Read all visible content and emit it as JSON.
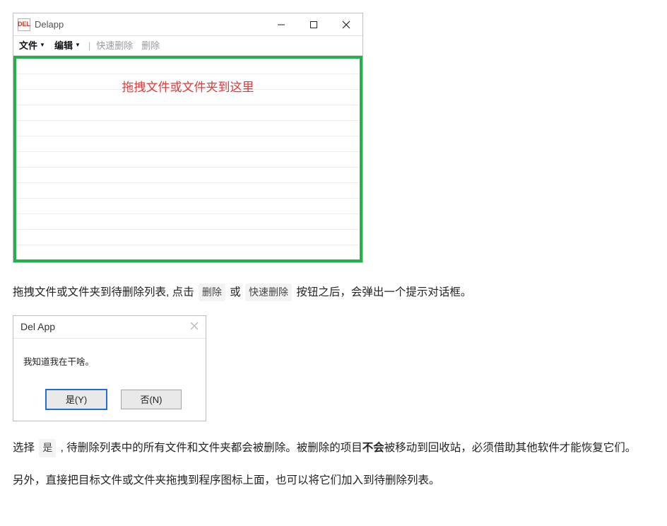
{
  "app": {
    "icon_text": "DEL",
    "title": "Delapp",
    "menu": {
      "file": "文件",
      "edit": "编辑",
      "quick_delete": "快速删除",
      "delete": "删除"
    },
    "drop_hint": "拖拽文件或文件夹到这里"
  },
  "text": {
    "para1_a": "拖拽文件或文件夹到待删除列表, 点击 ",
    "chip_delete": "删除",
    "para1_b": " 或 ",
    "chip_quick": "快速删除",
    "para1_c": " 按钮之后，会弹出一个提示对话框。",
    "para2_a": "选择 ",
    "chip_yes": "是",
    "para2_b": " , 待删除列表中的所有文件和文件夹都会被删除。被删除的项目",
    "para2_bold": "不会",
    "para2_c": "被移动到回收站，必须借助其他软件才能恢复它们。",
    "para3": "另外，直接把目标文件或文件夹拖拽到程序图标上面，也可以将它们加入到待删除列表。"
  },
  "dialog": {
    "title": "Del App",
    "message": "我知道我在干啥。",
    "yes": "是(Y)",
    "no": "否(N)"
  }
}
